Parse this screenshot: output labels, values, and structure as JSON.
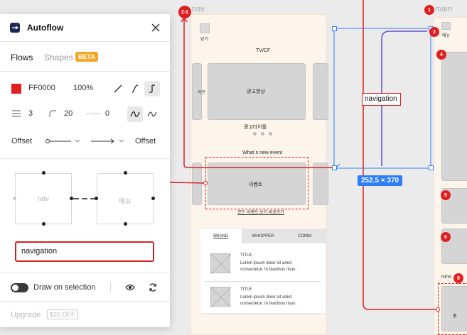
{
  "panel": {
    "title": "Autoflow",
    "tabs": {
      "flows": "Flows",
      "shapes": "Shapes",
      "beta": "BETA"
    },
    "color": {
      "hex": "FF0000",
      "opacity": "100%",
      "swatch": "#e02020"
    },
    "stroke": {
      "width": "3",
      "radius": "20",
      "dash": "0"
    },
    "offset": {
      "start_label": "Offset",
      "end_label": "Offset"
    },
    "preview": {
      "source": "nav",
      "target": "메뉴"
    },
    "label_value": "navigation",
    "draw_on_selection": "Draw on selection",
    "upgrade": "Upgrade",
    "price": "$20 OFF"
  },
  "canvas": {
    "frame_nav_label": "nav",
    "frame_main_label": "main",
    "badges": {
      "b21": "2-1",
      "b1": "1",
      "b2": "2",
      "b4": "4",
      "b5": "5",
      "b6": "6",
      "b8": "8"
    },
    "size_tag": "252.5 × 370",
    "connector_label": "navigation",
    "wireframe": {
      "back": "닫기",
      "tvcf": "TV/CF",
      "prev": "이전",
      "ad_video": "광고영상",
      "ad_title": "광고타이틀",
      "whats_new": "What`s new event",
      "event": "이벤트",
      "all_events": "모든 이벤트 보기 바로가기",
      "menu": "메뉴",
      "new_label": "NEW",
      "cart": "홈",
      "tabs": [
        "BRAND",
        "WHOPPER",
        "COMM."
      ],
      "items": [
        {
          "title": "TITLE",
          "body1": "Lorem ipsum dolor sit amet",
          "body2": "consectetur. In faucibus risus ."
        },
        {
          "title": "TITLE",
          "body1": "Lorem ipsum dolor sit amet",
          "body2": "consectetur. In faucibus risus ."
        }
      ]
    }
  },
  "colors": {
    "accent": "#e02020",
    "selection": "#2d7ff9",
    "frame_bg": "#fdf4ec"
  }
}
